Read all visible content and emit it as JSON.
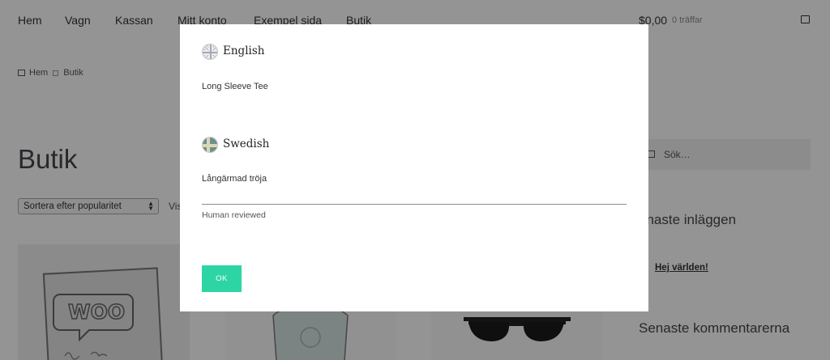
{
  "nav": {
    "items": [
      "Hem",
      "Vagn",
      "Kassan",
      "Mitt konto",
      "Exempel sida",
      "Butik"
    ],
    "cart_total": "$0,00",
    "cart_count": "0 träffar"
  },
  "breadcrumb": {
    "home": "Hem",
    "current": "Butik"
  },
  "page_title": "Butik",
  "sort": {
    "selected": "Sortera efter popularitet"
  },
  "show_label": "Vis",
  "sidebar": {
    "search_placeholder": "Sök…",
    "recent_posts_title": "enaste inläggen",
    "recent_post_link": "Hej världen!",
    "recent_comments_title": "Senaste kommentarerna"
  },
  "modal": {
    "source_language": "English",
    "source_text": "Long Sleeve Tee",
    "target_language": "Swedish",
    "target_text": "Långärmad tröja",
    "status": "Human reviewed",
    "ok_label": "OK"
  },
  "colors": {
    "ok_button": "#2ed5a4",
    "overlay": "rgba(0,0,0,0.42)"
  }
}
